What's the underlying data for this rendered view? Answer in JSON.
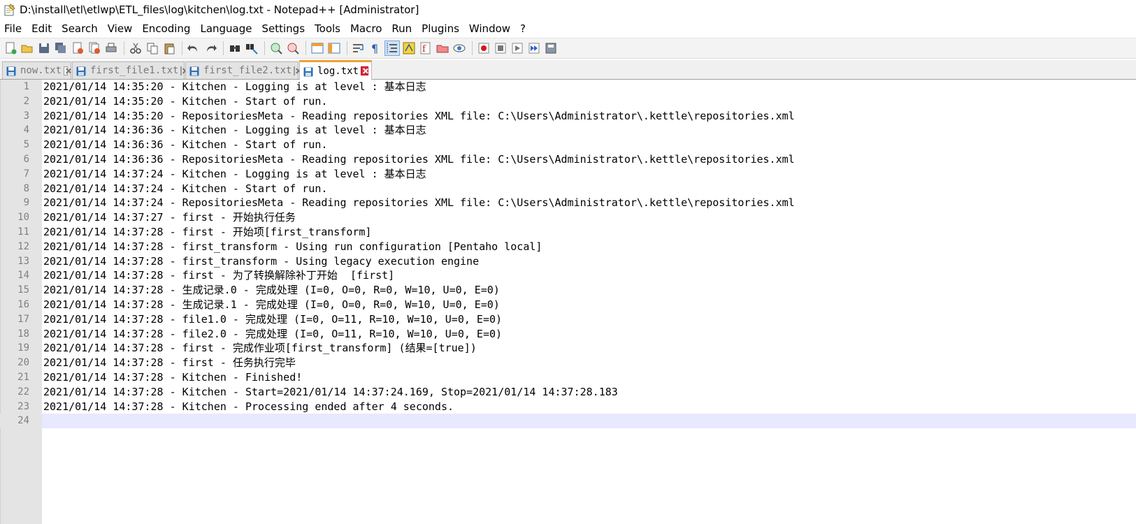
{
  "window": {
    "title": "D:\\install\\etl\\etlwp\\ETL_files\\log\\kitchen\\log.txt - Notepad++ [Administrator]"
  },
  "menu": [
    "File",
    "Edit",
    "Search",
    "View",
    "Encoding",
    "Language",
    "Settings",
    "Tools",
    "Macro",
    "Run",
    "Plugins",
    "Window",
    "?"
  ],
  "toolbar": {
    "groups": [
      [
        "new-file-icon",
        "open-file-icon",
        "save-icon",
        "save-all-icon",
        "close-icon",
        "close-all-icon",
        "print-icon"
      ],
      [
        "cut-icon",
        "copy-icon",
        "paste-icon"
      ],
      [
        "undo-icon",
        "redo-icon"
      ],
      [
        "find-icon",
        "replace-icon"
      ],
      [
        "zoom-in-icon",
        "zoom-out-icon"
      ],
      [
        "sync-vertical-icon",
        "sync-horizontal-icon"
      ],
      [
        "word-wrap-icon",
        "show-all-chars-icon",
        "indent-guide-icon",
        "udl-icon",
        "function-list-icon",
        "folder-workspace-icon",
        "monitoring-icon"
      ],
      [
        "record-macro-icon",
        "stop-macro-icon",
        "play-macro-icon",
        "run-macro-multiple-icon",
        "save-macro-icon"
      ]
    ],
    "active": "indent-guide-icon"
  },
  "tabs": [
    {
      "label": "now.txt",
      "active": false
    },
    {
      "label": "first_file1.txt",
      "active": false
    },
    {
      "label": "first_file2.txt",
      "active": false
    },
    {
      "label": "log.txt",
      "active": true
    }
  ],
  "editor": {
    "current_line": 24,
    "lines": [
      {
        "num": "1",
        "text": "2021/01/14 14:35:20 - Kitchen - Logging is at level : 基本日志"
      },
      {
        "num": "2",
        "text": "2021/01/14 14:35:20 - Kitchen - Start of run."
      },
      {
        "num": "3",
        "text": "2021/01/14 14:35:20 - RepositoriesMeta - Reading repositories XML file: C:\\Users\\Administrator\\.kettle\\repositories.xml"
      },
      {
        "num": "4",
        "text": "2021/01/14 14:36:36 - Kitchen - Logging is at level : 基本日志"
      },
      {
        "num": "5",
        "text": "2021/01/14 14:36:36 - Kitchen - Start of run."
      },
      {
        "num": "6",
        "text": "2021/01/14 14:36:36 - RepositoriesMeta - Reading repositories XML file: C:\\Users\\Administrator\\.kettle\\repositories.xml"
      },
      {
        "num": "7",
        "text": "2021/01/14 14:37:24 - Kitchen - Logging is at level : 基本日志"
      },
      {
        "num": "8",
        "text": "2021/01/14 14:37:24 - Kitchen - Start of run."
      },
      {
        "num": "9",
        "text": "2021/01/14 14:37:24 - RepositoriesMeta - Reading repositories XML file: C:\\Users\\Administrator\\.kettle\\repositories.xml"
      },
      {
        "num": "10",
        "text": "2021/01/14 14:37:27 - first - 开始执行任务"
      },
      {
        "num": "11",
        "text": "2021/01/14 14:37:28 - first - 开始项[first_transform]"
      },
      {
        "num": "12",
        "text": "2021/01/14 14:37:28 - first_transform - Using run configuration [Pentaho local]"
      },
      {
        "num": "13",
        "text": "2021/01/14 14:37:28 - first_transform - Using legacy execution engine"
      },
      {
        "num": "14",
        "text": "2021/01/14 14:37:28 - first - 为了转换解除补丁开始  [first]"
      },
      {
        "num": "15",
        "text": "2021/01/14 14:37:28 - 生成记录.0 - 完成处理 (I=0, O=0, R=0, W=10, U=0, E=0)"
      },
      {
        "num": "16",
        "text": "2021/01/14 14:37:28 - 生成记录.1 - 完成处理 (I=0, O=0, R=0, W=10, U=0, E=0)"
      },
      {
        "num": "17",
        "text": "2021/01/14 14:37:28 - file1.0 - 完成处理 (I=0, O=11, R=10, W=10, U=0, E=0)"
      },
      {
        "num": "18",
        "text": "2021/01/14 14:37:28 - file2.0 - 完成处理 (I=0, O=11, R=10, W=10, U=0, E=0)"
      },
      {
        "num": "19",
        "text": "2021/01/14 14:37:28 - first - 完成作业项[first_transform] (结果=[true])"
      },
      {
        "num": "20",
        "text": "2021/01/14 14:37:28 - first - 任务执行完毕"
      },
      {
        "num": "21",
        "text": "2021/01/14 14:37:28 - Kitchen - Finished!"
      },
      {
        "num": "22",
        "text": "2021/01/14 14:37:28 - Kitchen - Start=2021/01/14 14:37:24.169, Stop=2021/01/14 14:37:28.183"
      },
      {
        "num": "23",
        "text": "2021/01/14 14:37:28 - Kitchen - Processing ended after 4 seconds."
      },
      {
        "num": "24",
        "text": ""
      }
    ]
  }
}
